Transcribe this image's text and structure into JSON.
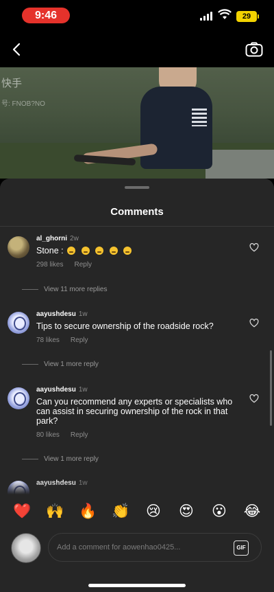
{
  "status_bar": {
    "time": "9:46",
    "battery": "29"
  },
  "video": {
    "watermark": "快手",
    "watermark_id": "号: FNOB?NO"
  },
  "comments_panel": {
    "title": "Comments",
    "comments": [
      {
        "username": "al_ghorni",
        "time": "2w",
        "text": "Stone :",
        "likes": "298 likes",
        "reply_label": "Reply",
        "more_replies": "View 11 more replies"
      },
      {
        "username": "aayushdesu",
        "time": "1w",
        "text": "Tips to secure ownership of the roadside rock?",
        "likes": "78 likes",
        "reply_label": "Reply",
        "more_replies": "View 1 more reply"
      },
      {
        "username": "aayushdesu",
        "time": "1w",
        "text": "Can you recommend any experts or specialists who can assist in securing ownership of the rock in that park?",
        "likes": "80 likes",
        "reply_label": "Reply",
        "more_replies": "View 1 more reply"
      },
      {
        "username": "aayushdesu",
        "time": "1w"
      }
    ]
  },
  "reactions": [
    "❤️",
    "🙌",
    "🔥",
    "👏",
    "😢",
    "😍",
    "😮",
    "😂"
  ],
  "input": {
    "placeholder": "Add a comment for aowenhao0425...",
    "gif_label": "GIF"
  }
}
